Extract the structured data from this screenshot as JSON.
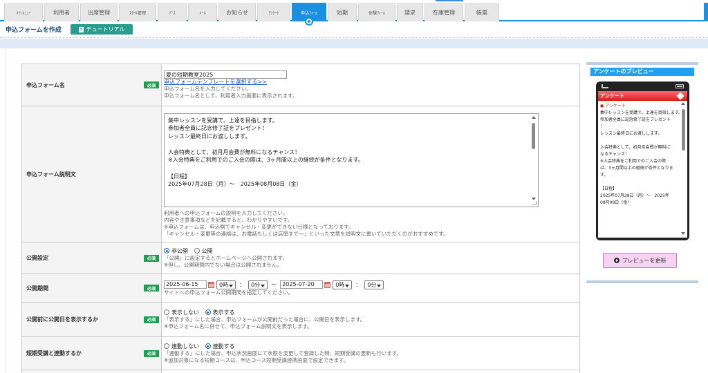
{
  "nav": {
    "tabs": [
      {
        "label": "ﾒｲﾝﾒﾆｭｰ",
        "small": true
      },
      {
        "label": "利用者",
        "small": false
      },
      {
        "label": "出席管理",
        "small": false
      },
      {
        "label": "ｽｸｰﾙ管理",
        "small": true
      },
      {
        "label": "ﾊﾟｽ",
        "small": true
      },
      {
        "label": "ﾒｰﾙ",
        "small": true
      },
      {
        "label": "お知らせ",
        "small": false
      },
      {
        "label": "ｱﾝｹｰﾄ",
        "small": true
      },
      {
        "label": "申込ﾌｫｰﾑ",
        "small": true,
        "active": true
      },
      {
        "label": "短期",
        "small": false
      },
      {
        "label": "体験ﾌｫｰﾑ",
        "small": true
      },
      {
        "label": "請求",
        "small": false
      },
      {
        "label": "在庫管理",
        "small": false
      },
      {
        "label": "帳票",
        "small": false
      }
    ]
  },
  "header": {
    "title": "申込フォームを作成",
    "tutorial_label": "チュートリアル"
  },
  "form": {
    "required_badge": "必須",
    "name": {
      "label": "申込フォーム名",
      "value": "夏の短期教室2025",
      "template_link": "申込フォームテンプレートを選択する>>",
      "help1": "申込フォーム名を入力してください。",
      "help2": "申込フォーム名として、利用者入力画面に表示されます。"
    },
    "description": {
      "label": "申込フォーム説明文",
      "lines": [
        "集中レッスンを受講で、上達を目指します。",
        "参加者全員に記念修了証をプレゼント！",
        "レッスン最終日にお渡しします。",
        "",
        "入会特典として、初月月会費が無料になるチャンス！",
        "※入会特典をご利用でのご入会の際は、3ヶ月間以上の継続が条件となります。",
        "",
        "【日程】",
        "2025年07月28日（月）～　2025年08月08日（金）"
      ],
      "help1": "利用者への申込フォームの説明を入力してください。",
      "help2": "内容や注意事項などを記載すると、わかりやすいです。",
      "help3": "※申込フォームは、申込側でキャンセル・変更ができない仕様となっております。",
      "help4": "「キャンセル・変更等の連絡は、お電話もしくは店頭まで～」といった文章を説明文に書いていただくのがおすすめです。"
    },
    "publish": {
      "label": "公開設定",
      "option_private": "非公開",
      "option_public": "公開",
      "selected": "private",
      "help1": "「公開」に設定するとホームページへ公開されます。",
      "help2": "※但し、公開期間内でない場合は公開されません。"
    },
    "period": {
      "label": "公開期間",
      "start_date": "2025-06-15",
      "start_hour": "0時",
      "start_min": "0分",
      "end_date": "2025-07-20",
      "end_hour": "0時",
      "end_min": "0分",
      "colon": "：",
      "tilde": "～",
      "help1": "サイトへの申込フォーム公開期間を指定してください。"
    },
    "show_date": {
      "label": "公開前に公開日を表示するか",
      "option_no": "表示しない",
      "option_yes": "表示する",
      "selected": "yes",
      "help1": "「表示する」にした場合、申込フォームが公開前だった場合に、公開日を表示します。",
      "help2": "※申込フォーム名に併せて、申込フォーム説明文を表示します。"
    },
    "link": {
      "label": "短期受講と連動するか",
      "option_no": "連動しない",
      "option_yes": "連動する",
      "selected": "yes",
      "help1": "「連動する」にした場合、申込状況画面にて状態を変更して登録した時、短期受講の更新も行います。",
      "help2": "※追加対象になる短期コースは、申込コース短期受講連携画面で設定できます。"
    }
  },
  "preview": {
    "title": "アンケートのプレビュー",
    "phone_title": "アンケート",
    "section_title": "● アンケート",
    "lines": [
      "集中レッスンを受講で、上達を目指します。",
      "参加者全員に記念修了証をプレゼント",
      "！",
      "レッスン最終日にお渡しします。",
      "",
      "入会特典として、初月月会費が無料に",
      "なるチャンス！",
      "※入会特典をご利用でのご入会の際",
      "は、3ヶ月間以上の継続が条件となりま",
      "す。",
      "",
      "【日程】",
      "2025年07月28日（月）～　2025年",
      "08月08日（金）"
    ],
    "refresh_label": "プレビューを更新"
  }
}
